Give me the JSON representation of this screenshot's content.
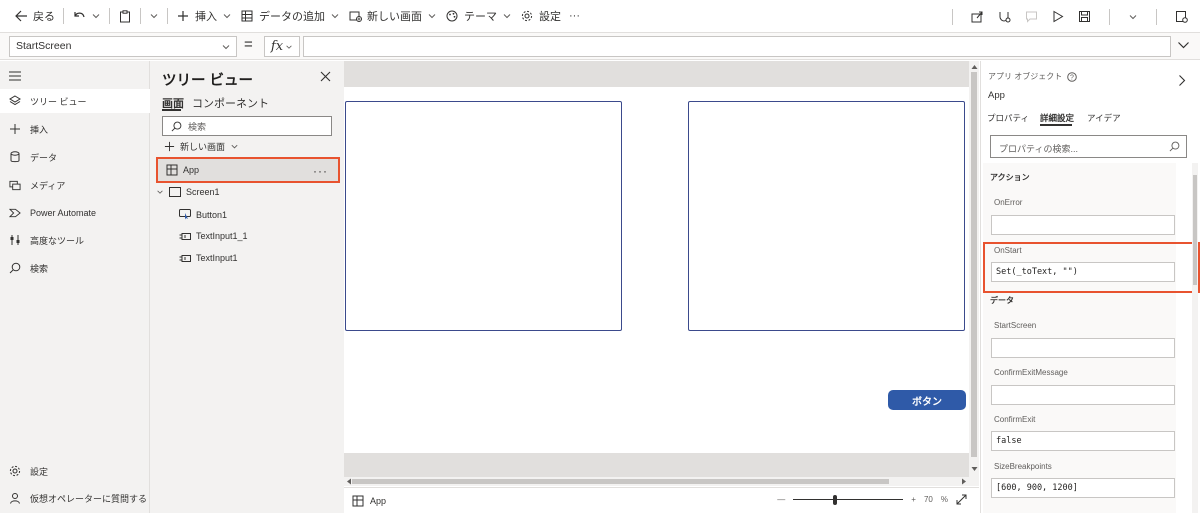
{
  "toolbar": {
    "back": "戻る",
    "insert": "挿入",
    "add_data": "データの追加",
    "new_screen": "新しい画面",
    "theme": "テーマ",
    "settings": "設定",
    "more": "···"
  },
  "formula": {
    "property": "StartScreen",
    "equals": "=",
    "fx": "fx",
    "value": ""
  },
  "leftnav": [
    {
      "label": "ツリー ビュー",
      "icon": "layers-icon",
      "active": true
    },
    {
      "label": "挿入",
      "icon": "plus-icon"
    },
    {
      "label": "データ",
      "icon": "database-icon"
    },
    {
      "label": "メディア",
      "icon": "media-icon"
    },
    {
      "label": "Power Automate",
      "icon": "power-automate-icon"
    },
    {
      "label": "高度なツール",
      "icon": "tools-icon"
    },
    {
      "label": "検索",
      "icon": "search-icon"
    }
  ],
  "leftnav_bottom": [
    {
      "label": "設定",
      "icon": "gear-icon"
    },
    {
      "label": "仮想オペレーターに質問する",
      "icon": "virtual-agent-icon"
    }
  ],
  "tree": {
    "title": "ツリー ビュー",
    "tabs": [
      "画面",
      "コンポーネント"
    ],
    "search_placeholder": "検索",
    "new_screen": "新しい画面",
    "app": "App",
    "screen": "Screen1",
    "children": [
      "Button1",
      "TextInput1_1",
      "TextInput1"
    ]
  },
  "canvas": {
    "button_label": "ボタン",
    "status_item": "App",
    "zoom_minus": "—",
    "zoom_plus": "+",
    "zoom_value": "70",
    "zoom_unit": "%",
    "zoom_level_percent": 70
  },
  "properties": {
    "object_label": "アプリ オブジェクト",
    "object_name": "App",
    "tabs": [
      "プロパティ",
      "詳細設定",
      "アイデア"
    ],
    "search_placeholder": "プロパティの検索...",
    "section_actions": "アクション",
    "section_data": "データ",
    "fields": [
      {
        "label": "OnError",
        "value": ""
      },
      {
        "label": "OnStart",
        "value": "Set(_toText, \"\")"
      },
      {
        "label": "StartScreen",
        "value": ""
      },
      {
        "label": "ConfirmExitMessage",
        "value": ""
      },
      {
        "label": "ConfirmExit",
        "value": "false"
      },
      {
        "label": "SizeBreakpoints",
        "value": "[600, 900, 1200]"
      }
    ]
  },
  "colors": {
    "highlight": "#e8532f",
    "button": "#2f5aa8",
    "control_border": "#3b4a8c"
  }
}
